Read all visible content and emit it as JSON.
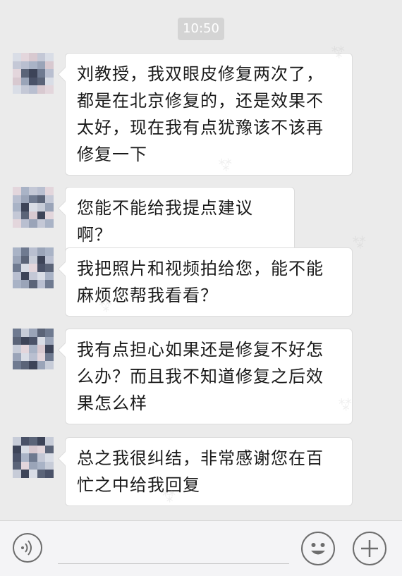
{
  "chat": {
    "timestamp": "10:50",
    "messages": [
      {
        "text": "刘教授，我双眼皮修复两次了，都是在北京修复的，还是效果不太好，现在我有点犹豫该不该再修复一下"
      },
      {
        "text": "您能不能给我提点建议啊？"
      },
      {
        "text": "我把照片和视频拍给您，能不能麻烦您帮我看看？"
      },
      {
        "text": "我有点担心如果还是修复不好怎么办？而且我不知道修复之后效果怎么样"
      },
      {
        "text": "总之我很纠结，非常感谢您在百忙之中给我回复"
      }
    ]
  },
  "input_bar": {
    "voice_icon": "voice-wave-icon",
    "emoji_icon": "smiley-face-icon",
    "plus_icon": "plus-icon"
  },
  "colors": {
    "background": "#ebebeb",
    "bubble": "#ffffff",
    "timestamp_bg": "#d4d4d4",
    "icon_stroke": "#6d6d6d"
  }
}
